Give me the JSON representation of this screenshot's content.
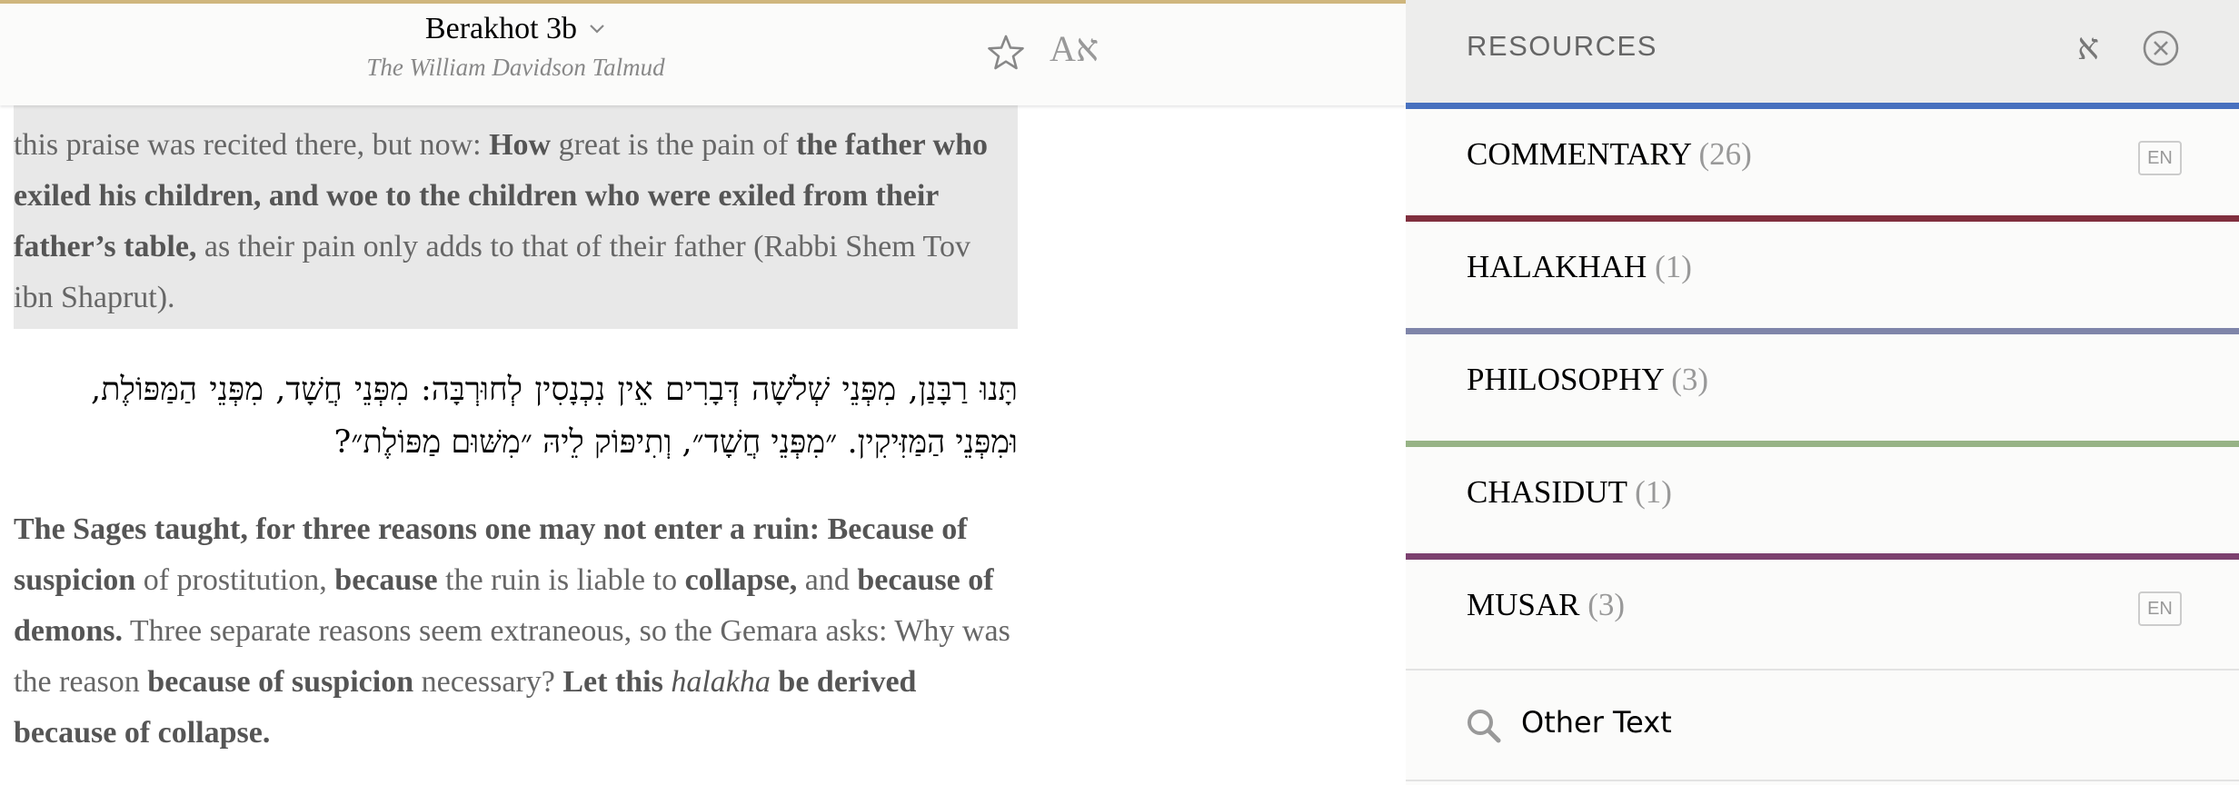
{
  "reader": {
    "title": "Berakhot 3b",
    "subtitle": "The William Davidson Talmud",
    "font_button_latin": "A",
    "font_button_hebrew": "א",
    "highlighted_segment_parts": [
      {
        "text": "this praise was recited there, but now: ",
        "bold": false
      },
      {
        "text": "How",
        "bold": true
      },
      {
        "text": " great is the pain of ",
        "bold": false
      },
      {
        "text": "the father who exiled his children, and woe to the children who were exiled from their father’s table,",
        "bold": true
      },
      {
        "text": " as their pain only adds to that of their father (Rabbi Shem Tov ibn Shaprut).",
        "bold": false
      }
    ],
    "hebrew_text": "תָּנוּ רַבָּנַן, מִפְּנֵי שְׁלֹשָׁה דְּבָרִים אֵין נִכְנָסִין לְחוּרְבָּה: מִפְּנֵי חֲשָׁד, מִפְּנֵי הַמַּפּוֹלֶת, וּמִפְּנֵי הַמַּזִּיקִין. ״מִפְּנֵי חֲשָׁד״, וְתִיפּוֹק לֵיהּ ״מִשּׁוּם מַפּוֹלֶת״?",
    "english_parts": [
      {
        "text": "The Sages taught, for three reasons one may not enter a ruin: Because of suspicion",
        "style": "bold"
      },
      {
        "text": " of prostitution, ",
        "style": "normal"
      },
      {
        "text": "because",
        "style": "bold"
      },
      {
        "text": " the ruin is liable to ",
        "style": "normal"
      },
      {
        "text": "collapse,",
        "style": "bold"
      },
      {
        "text": " and ",
        "style": "normal"
      },
      {
        "text": "because of demons.",
        "style": "bold"
      },
      {
        "text": " Three separate reasons seem extraneous, so the Gemara asks: Why was the reason ",
        "style": "normal"
      },
      {
        "text": "because of suspicion",
        "style": "bold"
      },
      {
        "text": " necessary? ",
        "style": "normal"
      },
      {
        "text": "Let this ",
        "style": "bold"
      },
      {
        "text": "halakha",
        "style": "italic"
      },
      {
        "text": " be derived because of collapse.",
        "style": "bold"
      }
    ]
  },
  "panel": {
    "title": "RESOURCES",
    "lang_icon": "א",
    "categories": [
      {
        "label": "COMMENTARY",
        "count": "(26)",
        "badge": "EN",
        "color": "#4871bf"
      },
      {
        "label": "HALAKHAH",
        "count": "(1)",
        "badge": "",
        "color": "#802f3e"
      },
      {
        "label": "PHILOSOPHY",
        "count": "(3)",
        "badge": "",
        "color": "#7f85a9"
      },
      {
        "label": "CHASIDUT",
        "count": "(1)",
        "badge": "",
        "color": "#97b386"
      },
      {
        "label": "MUSAR",
        "count": "(3)",
        "badge": "EN",
        "color": "#7c416f"
      }
    ],
    "other_text_label": "Other Text"
  },
  "colors": {
    "header_accent": "#cfb67d",
    "highlight_bg": "#e8e8e8"
  },
  "icons": [
    "chevron-down-icon",
    "star-icon",
    "font-size-icon",
    "hebrew-language-icon",
    "close-circle-icon",
    "search-icon"
  ]
}
